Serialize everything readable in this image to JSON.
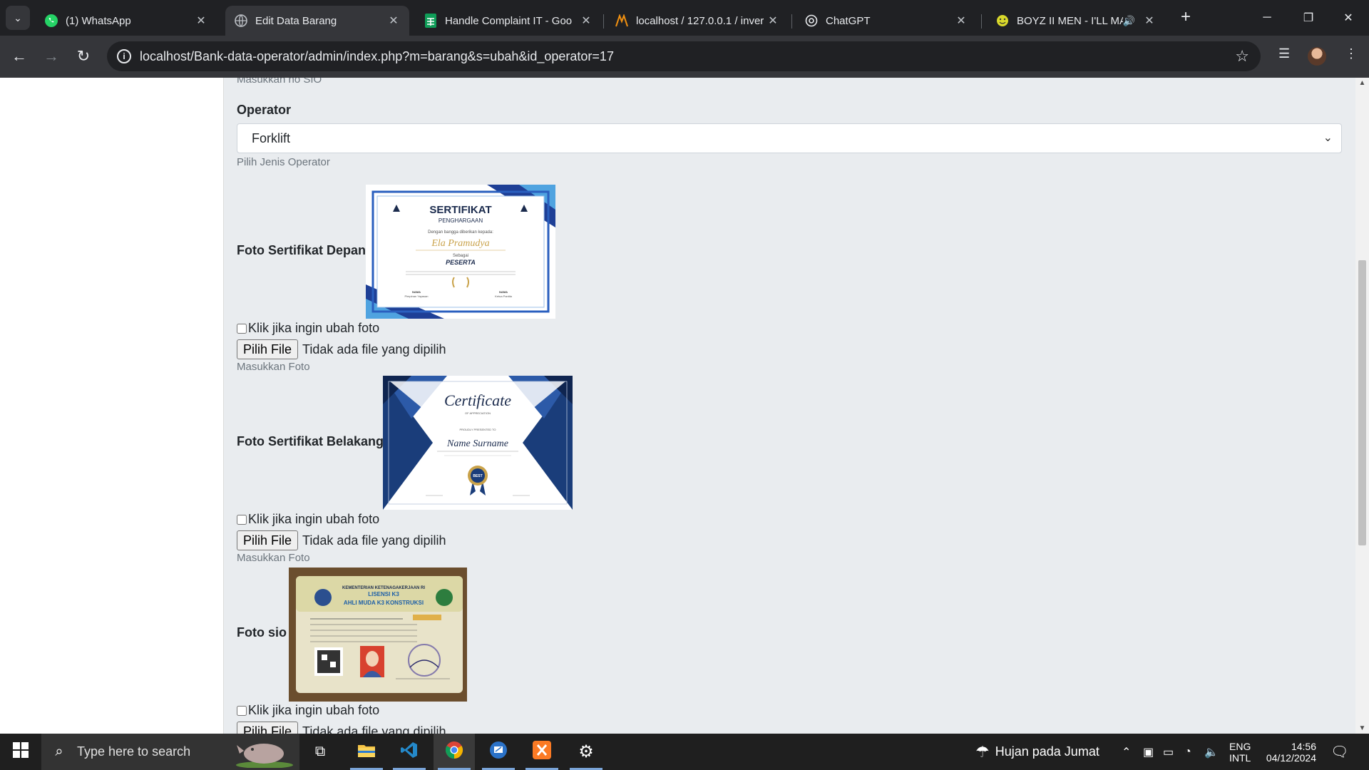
{
  "browser": {
    "tabs": [
      {
        "title": "(1) WhatsApp",
        "icon": "whatsapp-icon",
        "active": false
      },
      {
        "title": "Edit Data Barang",
        "icon": "globe-icon",
        "active": true
      },
      {
        "title": "Handle Complaint IT - Goo",
        "icon": "sheets-icon",
        "active": false
      },
      {
        "title": "localhost / 127.0.0.1 / inver",
        "icon": "phpmyadmin-icon",
        "active": false
      },
      {
        "title": "ChatGPT",
        "icon": "chatgpt-icon",
        "active": false
      },
      {
        "title": "BOYZ II MEN - I'LL MA",
        "icon": "smiley-icon",
        "active": false,
        "audio": true
      }
    ],
    "url": "localhost/Bank-data-operator/admin/index.php?m=barang&s=ubah&id_operator=17"
  },
  "form": {
    "top_help": "Masukkan no SIO",
    "operator": {
      "label": "Operator",
      "selected": "Forklift",
      "help": "Pilih Jenis Operator"
    },
    "sections": [
      {
        "label": "Foto Sertifikat Depan",
        "checkbox_label": "Klik jika ingin ubah foto",
        "file_button": "Pilih File",
        "file_status": "Tidak ada file yang dipilih",
        "help": "Masukkan Foto",
        "image": {
          "heading": "SERTIFIKAT",
          "subheading": "PENGHARGAAN",
          "line": "Dengan bangga diberikan kepada:",
          "name": "Ela Pramudya",
          "role_prefix": "Sebagai",
          "role": "PESERTA",
          "sign_left_name": "NAMA",
          "sign_left_title": "Pimpinan Yayasan",
          "sign_right_name": "NAMA",
          "sign_right_title": "Ketua Panitia"
        }
      },
      {
        "label": "Foto Sertifikat Belakang",
        "checkbox_label": "Klik jika ingin ubah foto",
        "file_button": "Pilih File",
        "file_status": "Tidak ada file yang dipilih",
        "help": "Masukkan Foto",
        "image": {
          "heading": "Certificate",
          "subheading": "OF APPRECIATION",
          "line": "PROUDLY PRESENTED TO",
          "name": "Name Surname",
          "badge": "BEST"
        }
      },
      {
        "label": "Foto sio",
        "checkbox_label": "Klik jika ingin ubah foto",
        "file_button": "Pilih File",
        "file_status": "Tidak ada file yang dipilih",
        "image": {
          "issuer": "KEMENTERIAN KETENAGAKERJAAN RI",
          "title1": "LISENSI K3",
          "title2": "AHLI MUDA K3 KONSTRUKSI"
        }
      }
    ]
  },
  "taskbar": {
    "search_placeholder": "Type here to search",
    "weather": "Hujan pada Jumat",
    "lang1": "ENG",
    "lang2": "INTL",
    "time": "14:56",
    "date": "04/12/2024"
  }
}
